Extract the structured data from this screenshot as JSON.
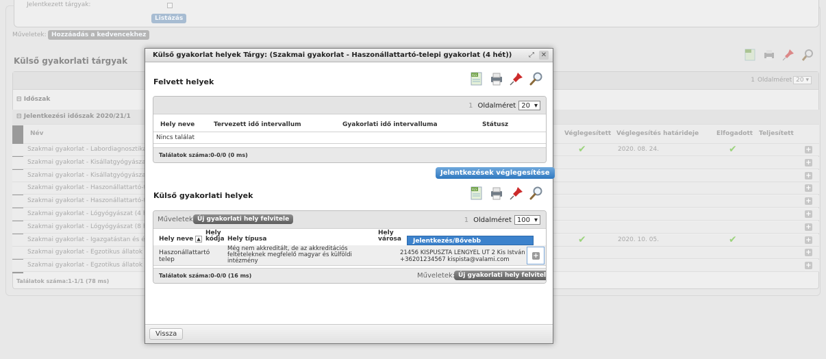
{
  "background": {
    "jelentkezett_label": "Jelentkezett tárgyak:",
    "listazas_button": "Listázás",
    "muveletek_label": "Műveletek:",
    "kedvencek_button": "Hozzáadás a kedvencekhez",
    "section_title": "Külső gyakorlati tárgyak",
    "oldalmeret_label": "Oldalméret",
    "oldalmeret_value": "20",
    "page_num": "1",
    "idoszak_label": "Időszak",
    "jelentkezesi_idoszak": "Jelentkezési időszak 2020/21/1",
    "columns": {
      "nev": "Név",
      "veglegesitett": "Véglegesített",
      "hatarideje": "Véglegesítés határideje",
      "elfogadott": "Elfogadott",
      "teljesitett": "Teljesített"
    },
    "rows": [
      {
        "name": "Szakmai gyakorlat - Labordiagnosztika",
        "veglegesitett": true,
        "hatarido": "2020. 08. 24.",
        "elfogadott": true
      },
      {
        "name": "Szakmai gyakorlat - Kisállatgyógyászat (",
        "veglegesitett": false,
        "hatarido": "",
        "elfogadott": false
      },
      {
        "name": "Szakmai gyakorlat - Kisállatgyógyászat (",
        "veglegesitett": false,
        "hatarido": "",
        "elfogadott": false
      },
      {
        "name": "Szakmai gyakorlat - Haszonállattartó-tele",
        "veglegesitett": false,
        "hatarido": "",
        "elfogadott": false
      },
      {
        "name": "Szakmai gyakorlat - Haszonállattartó-tele",
        "veglegesitett": false,
        "hatarido": "",
        "elfogadott": false
      },
      {
        "name": "Szakmai gyakorlat - Lógyógyászat (4 hét",
        "veglegesitett": false,
        "hatarido": "",
        "elfogadott": false
      },
      {
        "name": "Szakmai gyakorlat - Lógyógyászat (8 hét",
        "veglegesitett": false,
        "hatarido": "",
        "elfogadott": false
      },
      {
        "name": "Szakmai gyakorlat - Igazgatástan és élel",
        "veglegesitett": true,
        "hatarido": "2020. 10. 05.",
        "elfogadott": true
      },
      {
        "name": "Szakmai gyakorlat - Egzotikus állatok gy",
        "veglegesitett": false,
        "hatarido": "",
        "elfogadott": false
      },
      {
        "name": "Szakmai gyakorlat - Egzotikus állatok gy",
        "veglegesitett": false,
        "hatarido": "",
        "elfogadott": false
      }
    ],
    "talalatok": "Találatok száma:1-1/1 (78 ms)"
  },
  "modal": {
    "title": "Külső gyakorlat helyek Tárgy: (Szakmai gyakorlat - Haszonállattartó-telepi gyakorlat (4 hét))",
    "section1": {
      "title": "Felvett helyek",
      "page_num": "1",
      "oldalmeret_label": "Oldalméret",
      "oldalmeret_value": "20",
      "columns": [
        "Hely neve",
        "Tervezett idő intervallum",
        "Gyakorlati idő intervalluma",
        "Státusz"
      ],
      "empty_text": "Nincs találat",
      "talalatok": "Találatok száma:0-0/0 (0 ms)",
      "finalize_button": "Jelentkezések véglegesítése"
    },
    "section2": {
      "title": "Külső gyakorlati helyek",
      "muveletek_label": "Műveletek:",
      "new_button": "Új gyakorlati hely felvitele",
      "page_num": "1",
      "oldalmeret_label": "Oldalméret",
      "oldalmeret_value": "100",
      "col_hely_neve": "Hely neve",
      "col_hely_kodja": "Hely kódja",
      "col_hely_tipusa": "Hely típusa",
      "col_hely_varosa": "Hely városa",
      "dropdown_label": "Jelentkezés/Bővebb",
      "row": {
        "name": "Haszonállattartó telep",
        "type": "Még nem akkreditált, de az akkreditációs feltételeknek megfelelő magyar és külföldi intézmény",
        "address": "21456 KISPUSZTA LENGYEL UT 2 Kis István",
        "contact": "+36201234567 kispista@valami.com"
      },
      "talalatok": "Találatok száma:0-0/0 (16 ms)",
      "foot_muveletek": "Műveletek:",
      "foot_new_button": "Új gyakorlati hely felvitele"
    },
    "vissza_button": "Vissza"
  }
}
